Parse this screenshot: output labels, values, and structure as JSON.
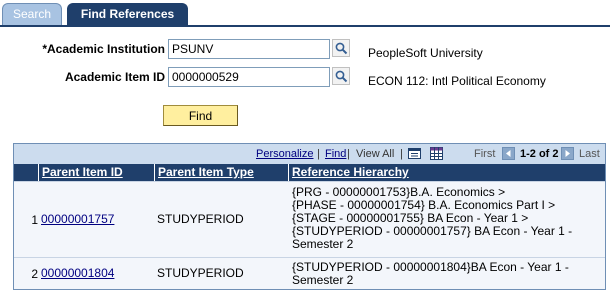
{
  "tabs": [
    {
      "label": "Search",
      "active": false
    },
    {
      "label": "Find References",
      "active": true
    }
  ],
  "form": {
    "institution_label": "*Academic Institution",
    "institution_value": "PSUNV",
    "institution_desc": "PeopleSoft University",
    "item_id_label": "Academic Item ID",
    "item_id_value": "0000000529",
    "item_id_desc": "ECON  112: Intl Political Economy",
    "find_label": "Find"
  },
  "grid": {
    "nav": {
      "personalize": "Personalize",
      "find": "Find",
      "view_all": "View All",
      "sep": "|",
      "first": "First",
      "range": "1-2 of 2",
      "last": "Last"
    },
    "columns": [
      "Parent Item ID",
      "Parent Item Type",
      "Reference Hierarchy"
    ],
    "rows": [
      {
        "num": "1",
        "parent_id": "00000001757",
        "parent_type": "STUDYPERIOD",
        "hierarchy": [
          "{PRG - 00000001753}B.A. Economics >",
          "{PHASE - 00000001754}  B.A. Economics Part I >",
          "{STAGE - 00000001755}  BA Econ - Year 1 >",
          "{STUDYPERIOD - 00000001757}  BA Econ - Year 1 -",
          "Semester 2"
        ]
      },
      {
        "num": "2",
        "parent_id": "00000001804",
        "parent_type": "STUDYPERIOD",
        "hierarchy": [
          "{STUDYPERIOD - 00000001804}BA Econ - Year 1 -",
          "Semester 2"
        ]
      }
    ]
  },
  "colors": {
    "header_bg": "#1f3f6b",
    "nav_bg": "#ccdcee",
    "find_button": "#ffef9f",
    "link": "#000080"
  }
}
